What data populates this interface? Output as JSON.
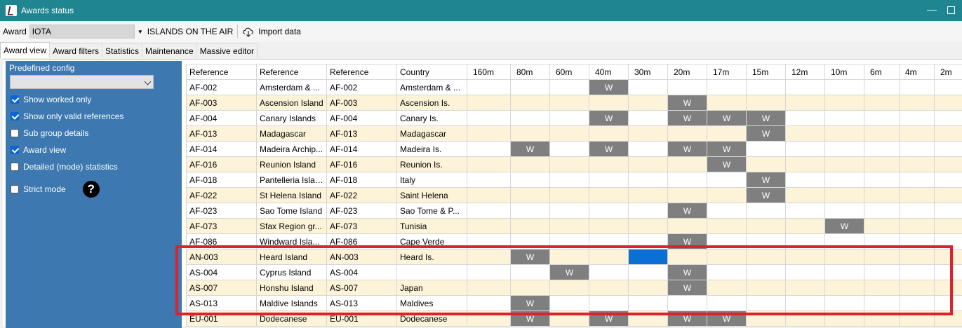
{
  "window": {
    "title": "Awards status"
  },
  "toolbar": {
    "award_label": "Award",
    "award_value": "IOTA",
    "award_name": "ISLANDS ON THE AIR",
    "import_label": "Import data"
  },
  "tabs": [
    "Award view",
    "Award filters",
    "Statistics",
    "Maintenance",
    "Massive editor"
  ],
  "sidebar": {
    "predefined_label": "Predefined config",
    "predefined_value": "",
    "options": [
      {
        "label": "Show worked only",
        "checked": true
      },
      {
        "label": "Show only valid references",
        "checked": true
      },
      {
        "label": "Sub group details",
        "checked": false
      },
      {
        "label": "Award view",
        "checked": true
      },
      {
        "label": "Detailed (mode) statistics",
        "checked": false
      },
      {
        "label": "Strict mode",
        "checked": false
      }
    ]
  },
  "grid": {
    "headers": [
      "Reference",
      "Reference",
      "Reference",
      "Country",
      "160m",
      "80m",
      "60m",
      "40m",
      "30m",
      "20m",
      "17m",
      "15m",
      "12m",
      "10m",
      "6m",
      "4m",
      "2m"
    ],
    "worked_mark": "W",
    "rows": [
      {
        "ref": "AF-002",
        "name": "Amsterdam & ...",
        "ref2": "AF-002",
        "country": "Amsterdam & ...",
        "worked": [
          "40m"
        ]
      },
      {
        "ref": "AF-003",
        "name": "Ascension Island",
        "ref2": "AF-003",
        "country": "Ascension Is.",
        "worked": [
          "20m"
        ]
      },
      {
        "ref": "AF-004",
        "name": "Canary Islands",
        "ref2": "AF-004",
        "country": "Canary Is.",
        "worked": [
          "40m",
          "20m",
          "17m",
          "15m"
        ]
      },
      {
        "ref": "AF-013",
        "name": "Madagascar",
        "ref2": "AF-013",
        "country": "Madagascar",
        "worked": [
          "15m"
        ]
      },
      {
        "ref": "AF-014",
        "name": "Madeira Archip...",
        "ref2": "AF-014",
        "country": "Madeira Is.",
        "worked": [
          "80m",
          "40m",
          "20m",
          "17m"
        ]
      },
      {
        "ref": "AF-016",
        "name": "Reunion Island",
        "ref2": "AF-016",
        "country": "Reunion Is.",
        "worked": [
          "17m"
        ]
      },
      {
        "ref": "AF-018",
        "name": "Pantelleria Island",
        "ref2": "AF-018",
        "country": "Italy",
        "worked": [
          "15m"
        ]
      },
      {
        "ref": "AF-022",
        "name": "St Helena Island",
        "ref2": "AF-022",
        "country": "Saint Helena",
        "worked": [
          "15m"
        ]
      },
      {
        "ref": "AF-023",
        "name": "Sao Tome Island",
        "ref2": "AF-023",
        "country": "Sao Tome & P...",
        "worked": [
          "20m"
        ]
      },
      {
        "ref": "AF-073",
        "name": "Sfax Region gr...",
        "ref2": "AF-073",
        "country": "Tunisia",
        "worked": [
          "10m"
        ]
      },
      {
        "ref": "AF-086",
        "name": "Windward Isla...",
        "ref2": "AF-086",
        "country": "Cape Verde",
        "worked": [
          "20m"
        ]
      },
      {
        "ref": "AN-003",
        "name": "Heard Island",
        "ref2": "AN-003",
        "country": "Heard Is.",
        "worked": [
          "80m"
        ],
        "selected": [
          "30m"
        ]
      },
      {
        "ref": "AS-004",
        "name": "Cyprus Island",
        "ref2": "AS-004",
        "country": "",
        "worked": [
          "60m",
          "20m"
        ]
      },
      {
        "ref": "AS-007",
        "name": "Honshu Island",
        "ref2": "AS-007",
        "country": "Japan",
        "worked": [
          "20m"
        ]
      },
      {
        "ref": "AS-013",
        "name": "Maldive Islands",
        "ref2": "AS-013",
        "country": "Maldives",
        "worked": [
          "80m"
        ]
      },
      {
        "ref": "EU-001",
        "name": "Dodecanese",
        "ref2": "EU-001",
        "country": "Dodecanese",
        "worked": [
          "80m",
          "40m",
          "20m",
          "17m"
        ]
      }
    ]
  },
  "colors": {
    "titlebar": "#1f8590",
    "sidebar": "#3d78b0",
    "row_alt": "#fdf3d8",
    "worked_cell": "#7f7f7f",
    "selected_cell": "#0b6fd3",
    "highlight_box": "#e0202a"
  }
}
